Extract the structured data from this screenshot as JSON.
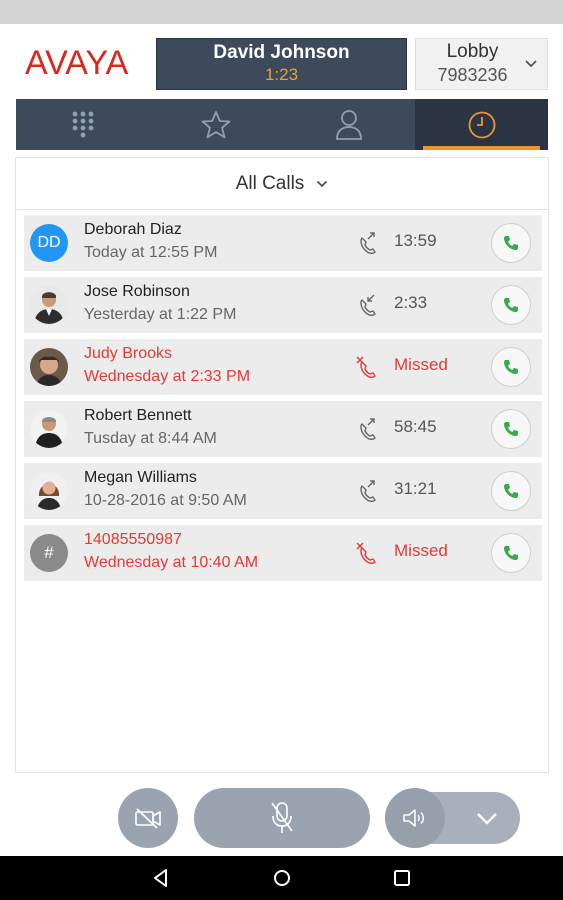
{
  "app": {
    "logo": "AVAYA",
    "active_call": {
      "name": "David Johnson",
      "timer": "1:23"
    },
    "lobby": {
      "name": "Lobby",
      "number": "7983236"
    }
  },
  "tabs": [
    {
      "name": "dialpad",
      "icon": "dialpad-icon",
      "active": false
    },
    {
      "name": "favorites",
      "icon": "star-icon",
      "active": false
    },
    {
      "name": "contacts",
      "icon": "person-icon",
      "active": false
    },
    {
      "name": "history",
      "icon": "clock-icon",
      "active": true
    }
  ],
  "filter": {
    "label": "All Calls"
  },
  "calls": [
    {
      "name": "Deborah Diaz",
      "time": "Today at 12:55 PM",
      "duration": "13:59",
      "type": "outgoing",
      "avatar": "DD",
      "missed": false
    },
    {
      "name": "Jose Robinson",
      "time": "Yesterday at 1:22 PM",
      "duration": "2:33",
      "type": "incoming",
      "avatar": "photo",
      "missed": false
    },
    {
      "name": "Judy Brooks",
      "time": "Wednesday at 2:33 PM",
      "duration": "Missed",
      "type": "missed",
      "avatar": "photo",
      "missed": true
    },
    {
      "name": "Robert Bennett",
      "time": "Tusday at 8:44 AM",
      "duration": "58:45",
      "type": "outgoing",
      "avatar": "photo",
      "missed": false
    },
    {
      "name": "Megan Williams",
      "time": "10-28-2016 at 9:50 AM",
      "duration": "31:21",
      "type": "outgoing",
      "avatar": "photo",
      "missed": false
    },
    {
      "name": "14085550987",
      "time": "Wednesday at 10:40 AM",
      "duration": "Missed",
      "type": "missed",
      "avatar": "#",
      "missed": true
    }
  ],
  "colors": {
    "brand": "#da291c",
    "header_bg": "#3c4a5c",
    "timer": "#f0a030",
    "tab_indicator": "#f0942a",
    "missed": "#e53935",
    "call_green": "#3aa94a",
    "avatar_blue": "#2196f3"
  },
  "controls": [
    "video-off-icon",
    "mic-off-icon",
    "speaker-icon",
    "chevron-down-icon"
  ]
}
